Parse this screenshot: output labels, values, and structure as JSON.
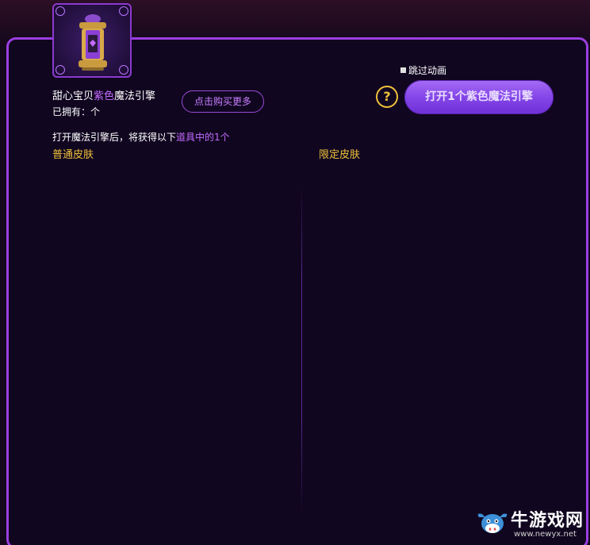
{
  "item": {
    "name_prefix": "甜心宝贝",
    "name_highlight": "紫色",
    "name_suffix": "魔法引擎",
    "owned_label": "已拥有：个",
    "image_icon": "magic-engine-icon"
  },
  "buttons": {
    "buy_more": "点击购买更多",
    "open": "打开1个紫色魔法引擎",
    "help": "?"
  },
  "skip_animation": {
    "label": "跳过动画",
    "checked": false
  },
  "description": {
    "prefix": "打开魔法引擎后，将获得以下",
    "highlight": "道具中的1个"
  },
  "columns": {
    "normal": "普通皮肤",
    "limited": "限定皮肤"
  },
  "watermark": {
    "text": "牛游戏网",
    "url": "www.newyx.net"
  },
  "colors": {
    "accent_purple": "#9a3fe0",
    "highlight_purple": "#c46bff",
    "gold": "#f0c23a",
    "panel_bg": "#100620"
  }
}
